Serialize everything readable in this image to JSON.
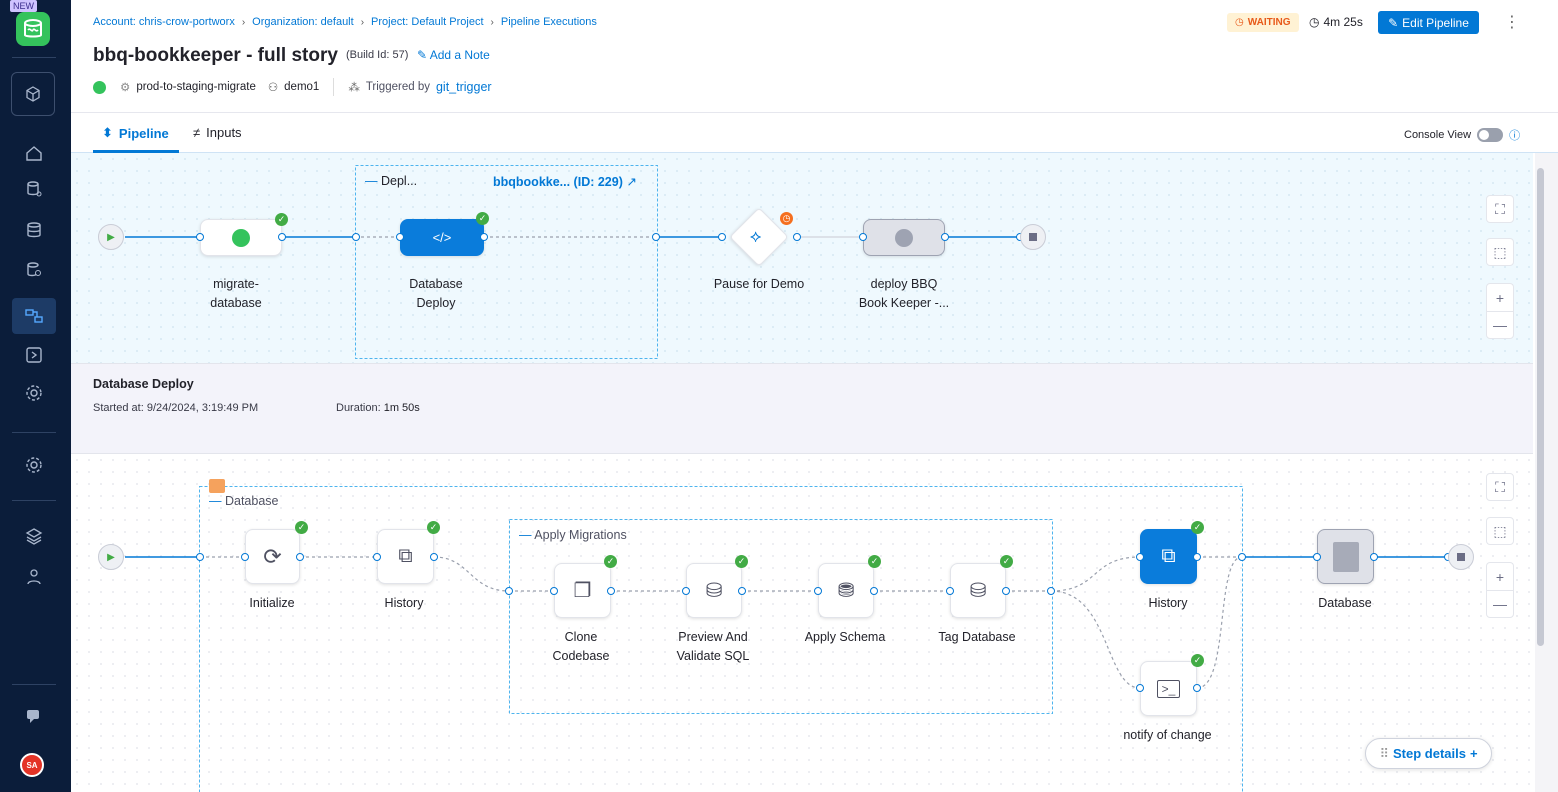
{
  "sidebar": {
    "new_badge": "NEW",
    "avatar": "SA",
    "icons": [
      "home-icon",
      "db-settings-icon",
      "database-stack-icon",
      "db-search-icon",
      "pipeline-icon",
      "deploy-icon",
      "gear-cog-icon",
      "settings-icon",
      "stack-icon",
      "users-icon",
      "chat-icon"
    ]
  },
  "breadcrumb": {
    "account": "Account: chris-crow-portworx",
    "org": "Organization: default",
    "project": "Project: Default Project",
    "section": "Pipeline Executions"
  },
  "header": {
    "title": "bbq-bookkeeper - full story",
    "build_id": "(Build Id: 57)",
    "add_note": "Add a Note",
    "env": "prod-to-staging-migrate",
    "user": "demo1",
    "triggered_by": "Triggered by",
    "trigger": "git_trigger",
    "status": "WAITING",
    "duration": "4m 25s",
    "edit": "Edit Pipeline"
  },
  "tabs": {
    "pipeline": "Pipeline",
    "inputs": "Inputs",
    "console": "Console View"
  },
  "top_graph": {
    "group_label": "Depl...",
    "group_link": "bbqbookke... (ID: 229)",
    "stages": [
      {
        "label": "migrate-\ndatabase"
      },
      {
        "label": "Database\nDeploy"
      },
      {
        "label": "Pause for Demo"
      },
      {
        "label": "deploy BBQ\nBook Keeper -..."
      }
    ]
  },
  "stage_info": {
    "title": "Database Deploy",
    "started_label": "Started at:",
    "started": "9/24/2024, 3:19:49 PM",
    "duration_label": "Duration:",
    "duration": "1m 50s"
  },
  "bottom_graph": {
    "outer_group": "Database",
    "inner_group": "Apply Migrations",
    "steps": [
      {
        "label": "Initialize"
      },
      {
        "label": "History"
      },
      {
        "label": "Clone\nCodebase"
      },
      {
        "label": "Preview And\nValidate SQL"
      },
      {
        "label": "Apply Schema"
      },
      {
        "label": "Tag Database"
      },
      {
        "label": "History"
      },
      {
        "label": "notify of change"
      },
      {
        "label": "Database"
      }
    ]
  },
  "step_details": "Step details",
  "colors": {
    "accent": "#0278d5",
    "success": "#42ab45",
    "sidebar": "#0b1d3a",
    "waiting": "#e85a1a"
  }
}
